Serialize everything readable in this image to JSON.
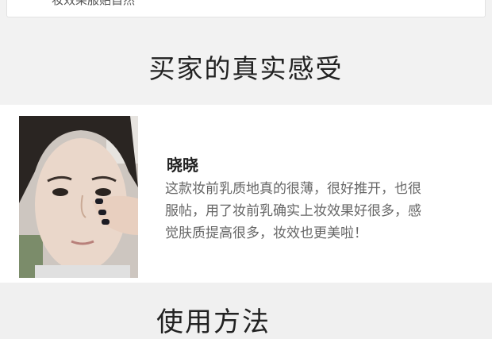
{
  "top_snippet": "妆效果服贴自然",
  "section_reviews": {
    "title": "买家的真实感受"
  },
  "review": {
    "name": "晓晓",
    "text": "这款妆前乳质地真的很薄，很好推开，也很服帖，用了妆前乳确实上妆效果好很多，感觉肤质提高很多，妆效也更美啦！"
  },
  "section_usage": {
    "title": "使用方法"
  }
}
